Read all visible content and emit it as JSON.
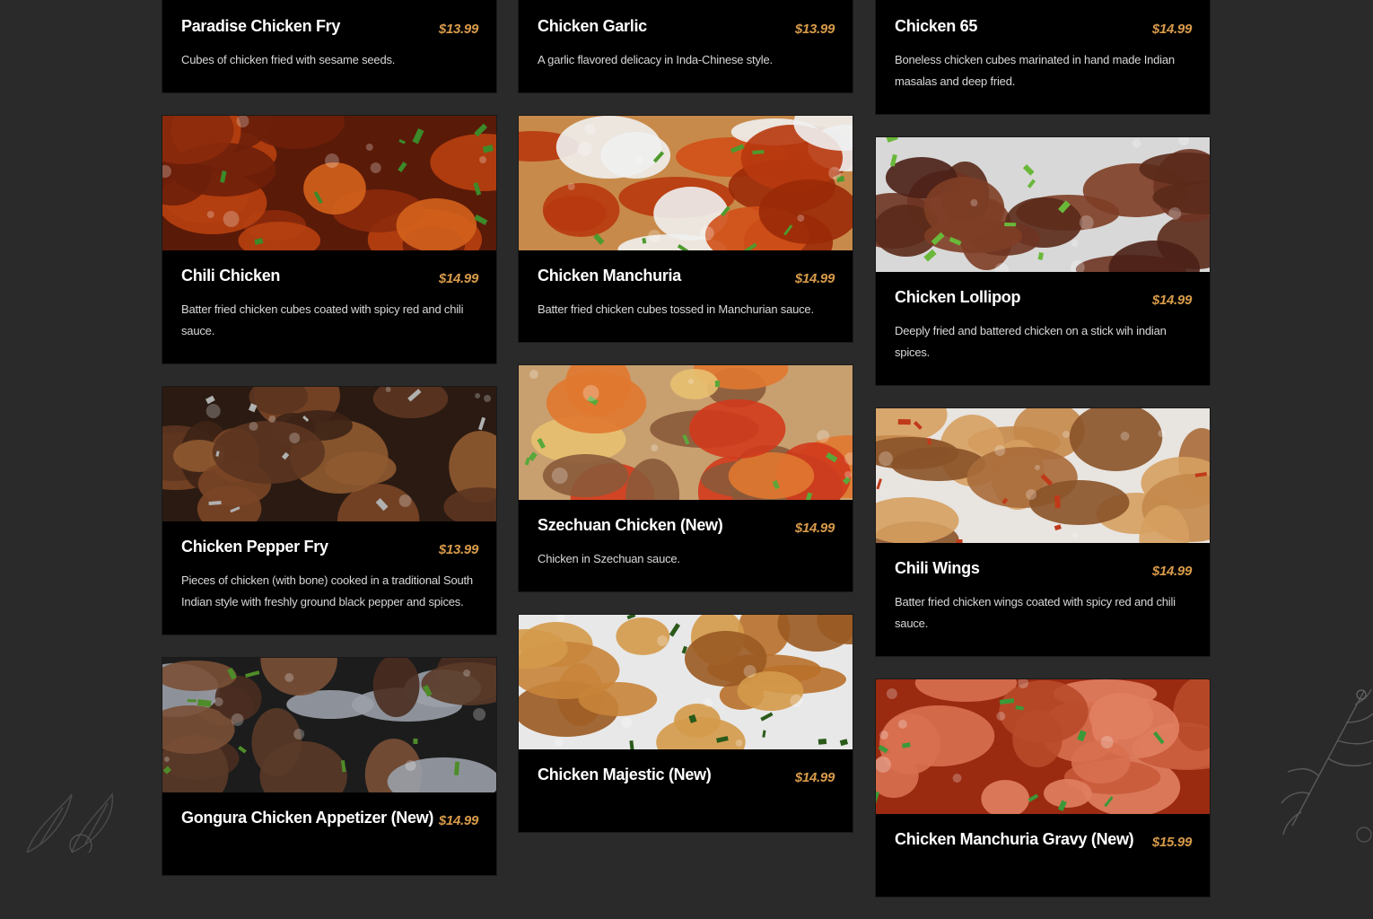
{
  "menu": {
    "columns": [
      [
        {
          "title": "Paradise Chicken Fry",
          "price": "$13.99",
          "desc": "Cubes of chicken fried with sesame seeds.",
          "image": false,
          "image_icon": ""
        },
        {
          "title": "Chili Chicken",
          "price": "$14.99",
          "desc": "Batter fried chicken cubes coated with spicy red and chili sauce.",
          "image": true,
          "image_icon": "chili-chicken-photo"
        },
        {
          "title": "Chicken Pepper Fry",
          "price": "$13.99",
          "desc": "Pieces of chicken (with bone) cooked in a traditional South Indian style with freshly ground black pepper and spices.",
          "image": true,
          "image_icon": "chicken-pepper-fry-photo"
        },
        {
          "title": "Gongura Chicken Appetizer (New)",
          "price": "$14.99",
          "desc": "",
          "image": true,
          "image_icon": "gongura-chicken-photo"
        }
      ],
      [
        {
          "title": "Chicken Garlic",
          "price": "$13.99",
          "desc": "A garlic flavored delicacy in Inda-Chinese style.",
          "image": false,
          "image_icon": ""
        },
        {
          "title": "Chicken Manchuria",
          "price": "$14.99",
          "desc": "Batter fried chicken cubes tossed in Manchurian sauce.",
          "image": true,
          "image_icon": "chicken-manchuria-photo"
        },
        {
          "title": "Szechuan Chicken (New)",
          "price": "$14.99",
          "desc": "Chicken in Szechuan sauce.",
          "image": true,
          "image_icon": "szechuan-chicken-photo"
        },
        {
          "title": "Chicken Majestic (New)",
          "price": "$14.99",
          "desc": "",
          "image": true,
          "image_icon": "chicken-majestic-photo"
        }
      ],
      [
        {
          "title": "Chicken 65",
          "price": "$14.99",
          "desc": "Boneless chicken cubes marinated in hand made Indian masalas and deep fried.",
          "image": false,
          "image_icon": ""
        },
        {
          "title": "Chicken Lollipop",
          "price": "$14.99",
          "desc": "Deeply fried and battered chicken on a stick wih indian spices.",
          "image": true,
          "image_icon": "chicken-lollipop-photo"
        },
        {
          "title": "Chili Wings",
          "price": "$14.99",
          "desc": "Batter fried chicken wings coated with spicy red and chili sauce.",
          "image": true,
          "image_icon": "chili-wings-photo"
        },
        {
          "title": "Chicken Manchuria Gravy (New)",
          "price": "$15.99",
          "desc": "",
          "image": true,
          "image_icon": "chicken-manchuria-gravy-photo"
        }
      ]
    ]
  },
  "colors": {
    "background": "#2a2a2a",
    "card": "#000000",
    "title": "#ffffff",
    "price": "#d89b4a",
    "description": "#d8d8d8"
  }
}
